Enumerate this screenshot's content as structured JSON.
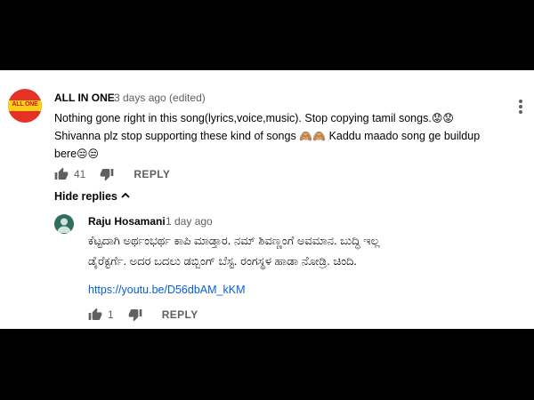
{
  "comment": {
    "author": "ALL IN ONE",
    "avatar_text": "ALL ONE",
    "time": "3 days ago (edited)",
    "text_line1": "Nothing gone right in this song(lyrics,voice,music).   Stop copying tamil songs.",
    "text_line2": "Shivanna plz stop supporting these kind of songs",
    "text_line2b": " Kaddu maado song ge buildup",
    "text_line3": "bere",
    "emoji_1": "😟😟",
    "emoji_2": "🙈🙈",
    "emoji_3": "😒😒",
    "likes": "41",
    "reply_label": "REPLY"
  },
  "replies_toggle": {
    "label": "Hide replies"
  },
  "reply": {
    "author": "Raju Hosamani",
    "time": "1 day ago",
    "text_line1": "ಕೆಟ್ಟದಾಗಿ ಅರ್ಥಂಭರ್ಥ ಕಾಪಿ ಮಾಡ್ತಾರ. ನಮ್ ಶಿವಣ್ಣಂಗೆ ಅವಮಾನ. ಬುದ್ಧಿ ಇಲ್ಲ",
    "text_line2": "ಡೈರೆಕ್ಟರ್ಗೆ. ಅದರ ಬದಲು ಡಬ್ಬಿಂಗ್ ಬೆಸ್ಟ. ರಂಗಸ್ಥಳ ಹಾಡಾ ನೋಡ್ರಿ. ಚಿಂದಿ.",
    "link": "https://youtu.be/D56dbAM_kKM",
    "likes": "1",
    "reply_label": "REPLY"
  },
  "colors": {
    "link": "#065fd4",
    "text_primary": "#030303",
    "text_secondary": "#606060",
    "avatar_main": "#e53126",
    "avatar_reply": "#2f6e5e"
  }
}
